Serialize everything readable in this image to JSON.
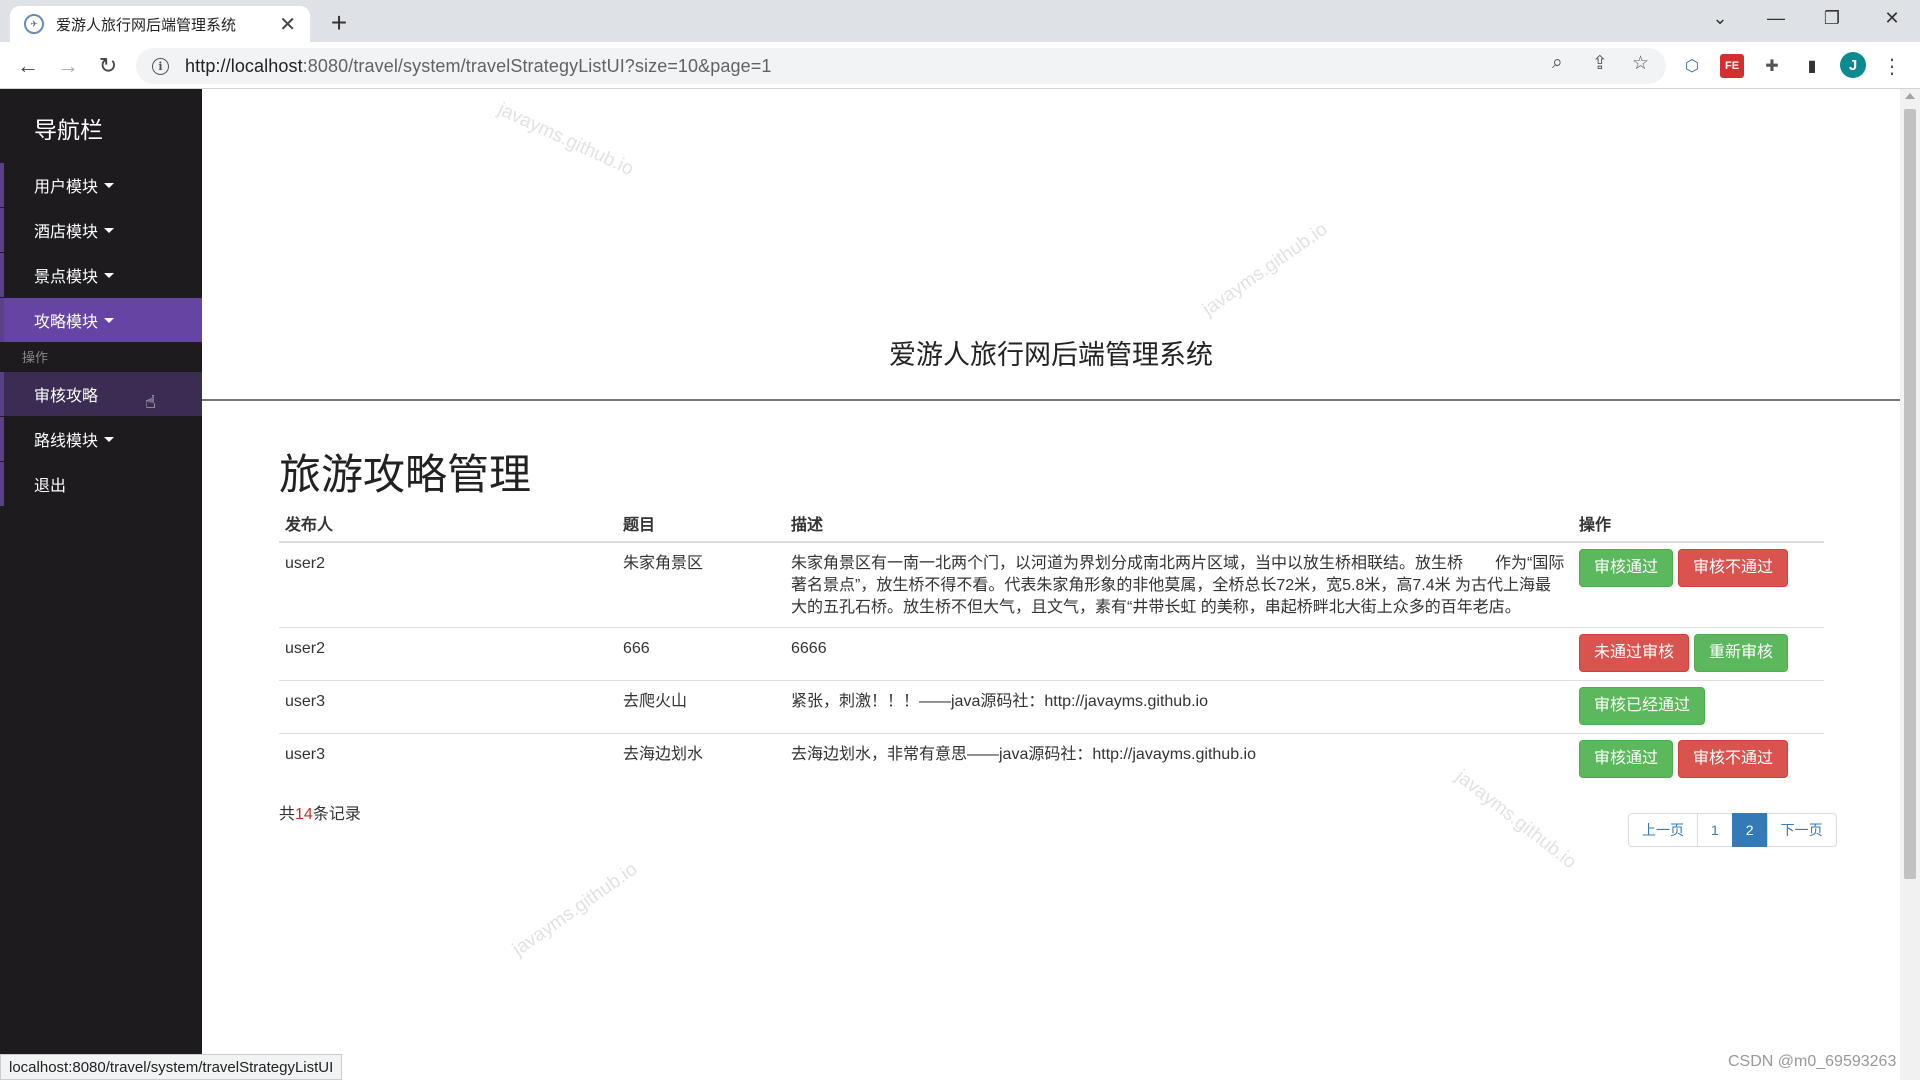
{
  "browser": {
    "tab_title": "爱游人旅行网后端管理系统",
    "tab_close": "✕",
    "new_tab": "+",
    "url_host": "http://localhost",
    "url_rest": ":8080/travel/system/travelStrategyListUI?size=10&page=1",
    "status_url": "localhost:8080/travel/system/travelStrategyListUI",
    "profile_initial": "J"
  },
  "sidebar": {
    "brand": "导航栏",
    "items": [
      {
        "label": "用户模块",
        "dropdown": true
      },
      {
        "label": "酒店模块",
        "dropdown": true
      },
      {
        "label": "景点模块",
        "dropdown": true
      },
      {
        "label": "攻略模块",
        "dropdown": true,
        "active": true
      },
      {
        "label": "审核攻略",
        "dropdown": false
      },
      {
        "label": "路线模块",
        "dropdown": true
      },
      {
        "label": "退出",
        "dropdown": false
      }
    ],
    "section_label": "操作"
  },
  "header": {
    "system_title": "爱游人旅行网后端管理系统"
  },
  "main": {
    "page_title": "旅游攻略管理",
    "columns": [
      "发布人",
      "题目",
      "描述",
      "操作"
    ],
    "rows": [
      {
        "publisher": "user2",
        "title": "朱家角景区",
        "desc": "朱家角景区有一南一北两个门，以河道为界划分成南北两片区域，当中以放生桥相联结。放生桥　　作为“国际著名景点”，放生桥不得不看。代表朱家角形象的非他莫属，全桥总长72米，宽5.8米，高7.4米 为古代上海最大的五孔石桥。放生桥不但大气，且文气，素有“井带长虹 的美称，串起桥畔北大街上众多的百年老店。",
        "actions": [
          {
            "label": "审核通过",
            "style": "success"
          },
          {
            "label": "审核不通过",
            "style": "danger"
          }
        ]
      },
      {
        "publisher": "user2",
        "title": "666",
        "desc": "6666",
        "actions": [
          {
            "label": "未通过审核",
            "style": "danger"
          },
          {
            "label": "重新审核",
            "style": "success"
          }
        ]
      },
      {
        "publisher": "user3",
        "title": "去爬火山",
        "desc": "紧张，刺激！！！——java源码社：http://javayms.github.io",
        "actions": [
          {
            "label": "审核已经通过",
            "style": "success"
          }
        ]
      },
      {
        "publisher": "user3",
        "title": "去海边划水",
        "desc": "去海边划水，非常有意思——java源码社：http://javayms.github.io",
        "actions": [
          {
            "label": "审核通过",
            "style": "success"
          },
          {
            "label": "审核不通过",
            "style": "danger"
          }
        ]
      }
    ],
    "total_prefix": "共",
    "total_count": "14",
    "total_suffix": "条记录",
    "pagination": [
      "上一页",
      "1",
      "2",
      "下一页"
    ],
    "current_page": "2"
  },
  "watermark_text": "javayms.github.io",
  "credit": "CSDN @m0_69593263"
}
